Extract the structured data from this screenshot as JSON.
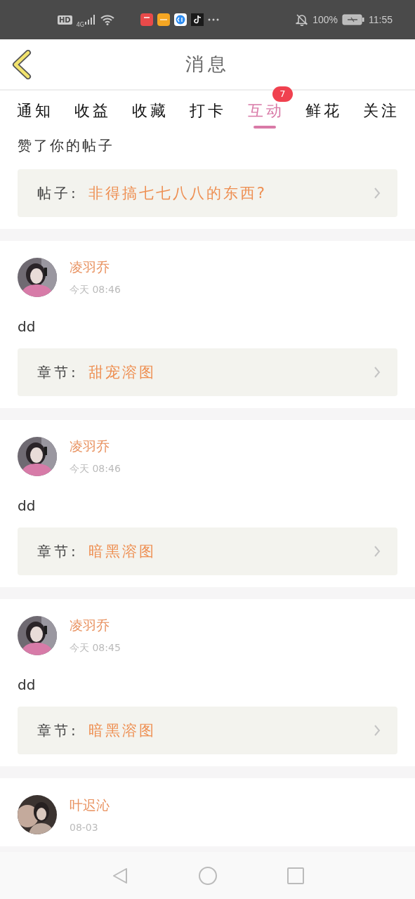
{
  "status_bar": {
    "hd": "HD",
    "network": "4G",
    "battery": "100%",
    "time": "11:55"
  },
  "header": {
    "title": "消息"
  },
  "tabs": [
    {
      "label": "通知",
      "selected": false
    },
    {
      "label": "收益",
      "selected": false
    },
    {
      "label": "收藏",
      "selected": false
    },
    {
      "label": "打卡",
      "selected": false
    },
    {
      "label": "互动",
      "selected": true,
      "badge": "7"
    },
    {
      "label": "鲜花",
      "selected": false
    },
    {
      "label": "关注",
      "selected": false
    }
  ],
  "items": [
    {
      "kind": "continued",
      "body": "赞了你的帖子",
      "ref_label": "帖子:",
      "ref_title": "非得搞七七八八的东西?"
    },
    {
      "kind": "full",
      "user": "凌羽乔",
      "time": "今天 08:46",
      "body": "dd",
      "ref_label": "章节:",
      "ref_title": "甜宠溶图"
    },
    {
      "kind": "full",
      "user": "凌羽乔",
      "time": "今天 08:46",
      "body": "dd",
      "ref_label": "章节:",
      "ref_title": "暗黑溶图"
    },
    {
      "kind": "full",
      "user": "凌羽乔",
      "time": "今天 08:45",
      "body": "dd",
      "ref_label": "章节:",
      "ref_title": "暗黑溶图"
    },
    {
      "kind": "header_only",
      "user": "叶迟沁",
      "time": "08-03"
    }
  ]
}
